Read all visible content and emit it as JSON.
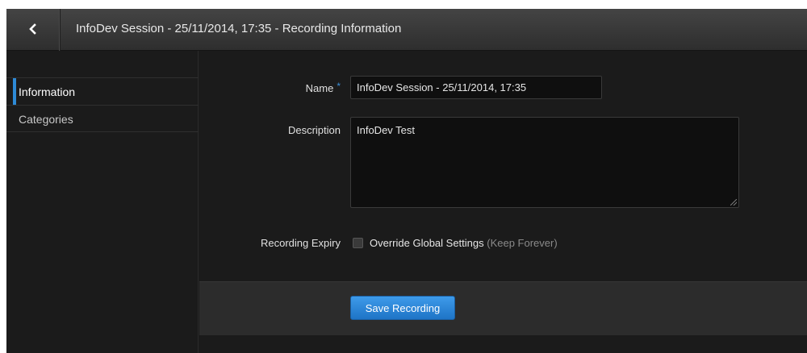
{
  "header": {
    "back_icon": "chevron-left-icon",
    "title": "InfoDev Session - 25/11/2014, 17:35 - Recording Information"
  },
  "sidebar": {
    "items": [
      {
        "label": "Information",
        "active": true
      },
      {
        "label": "Categories",
        "active": false
      }
    ]
  },
  "form": {
    "name": {
      "label": "Name",
      "required_marker": "*",
      "value": "InfoDev Session - 25/11/2014, 17:35"
    },
    "description": {
      "label": "Description",
      "value": "InfoDev Test"
    },
    "expiry": {
      "label": "Recording Expiry",
      "checkbox_label": "Override Global Settings",
      "hint": "(Keep Forever)",
      "checked": false
    }
  },
  "actions": {
    "save_label": "Save Recording"
  },
  "colors": {
    "accent": "#2e8ad6",
    "background": "#1b1b1b",
    "toolbar": "#2c2c2c"
  }
}
